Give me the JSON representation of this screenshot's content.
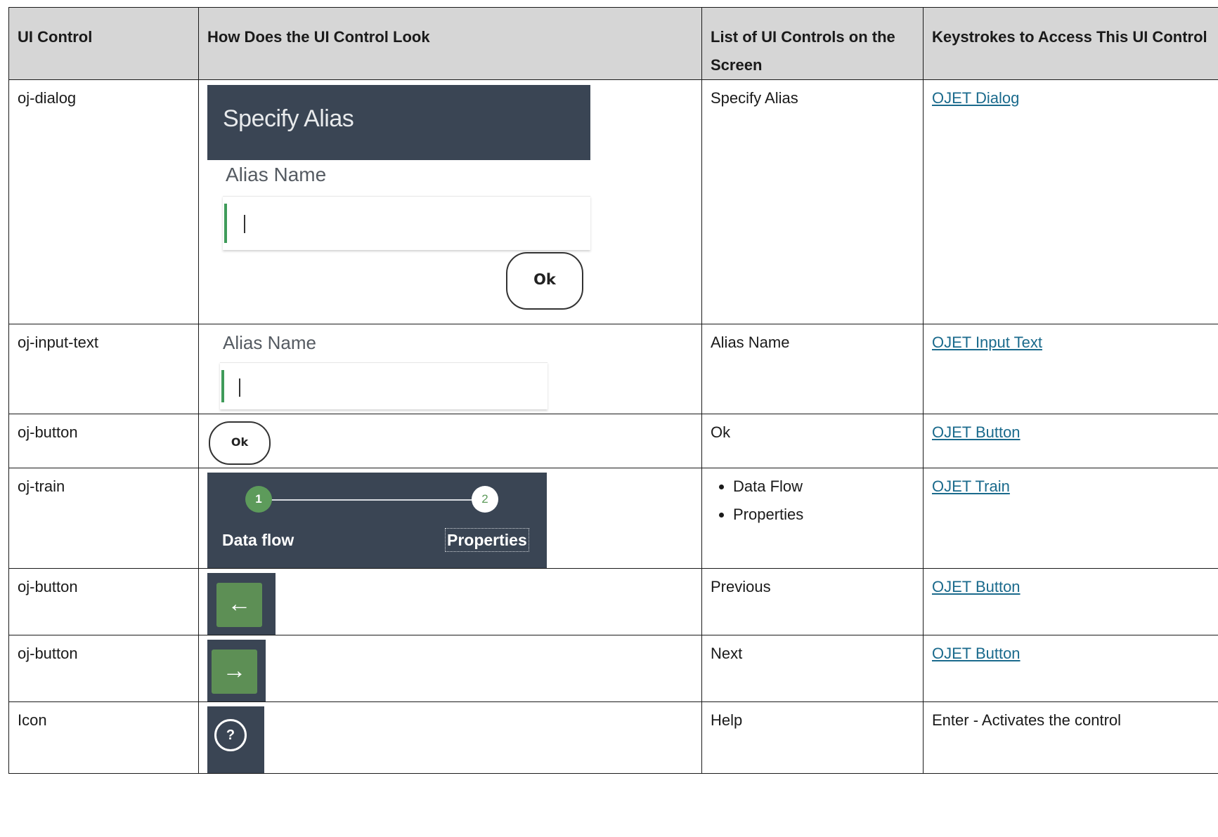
{
  "table": {
    "headers": [
      "UI Control",
      "How Does the UI Control Look",
      "List of UI Controls on the Screen",
      "Keystrokes to Access This UI Control"
    ],
    "rows": [
      {
        "control": "oj-dialog",
        "items": "Specify Alias",
        "keys": "OJET Dialog",
        "keys_is_link": true
      },
      {
        "control": "oj-input-text",
        "items": "Alias Name",
        "keys": "OJET Input Text",
        "keys_is_link": true
      },
      {
        "control": "oj-button",
        "items": "Ok",
        "keys": "OJET Button",
        "keys_is_link": true
      },
      {
        "control": "oj-train",
        "items_list": [
          "Data Flow",
          "Properties"
        ],
        "keys": "OJET Train",
        "keys_is_link": true
      },
      {
        "control": "oj-button",
        "items": "Previous",
        "keys": "OJET Button",
        "keys_is_link": true
      },
      {
        "control": "oj-button",
        "items": "Next",
        "keys": "OJET Button",
        "keys_is_link": true
      },
      {
        "control": "Icon",
        "items": "Help",
        "keys": "Enter - Activates the control",
        "keys_is_link": false
      }
    ]
  },
  "images": {
    "dialog": {
      "title": "Specify Alias",
      "field_label": "Alias Name",
      "button": "Ok"
    },
    "input": {
      "field_label": "Alias Name"
    },
    "button": {
      "label": "Ok"
    },
    "train": {
      "step1_num": "1",
      "step2_num": "2",
      "step1_label": "Data flow",
      "step2_label": "Properties"
    },
    "prev": {
      "icon": "arrow-left-icon",
      "glyph": "←"
    },
    "next": {
      "icon": "arrow-right-icon",
      "glyph": "→"
    },
    "help": {
      "icon": "help-icon",
      "glyph": "?"
    }
  },
  "colors": {
    "header_bg": "#d6d6d6",
    "dark_bg": "#3a4554",
    "accent_green": "#5d9b5b",
    "link": "#1a6a8c"
  }
}
